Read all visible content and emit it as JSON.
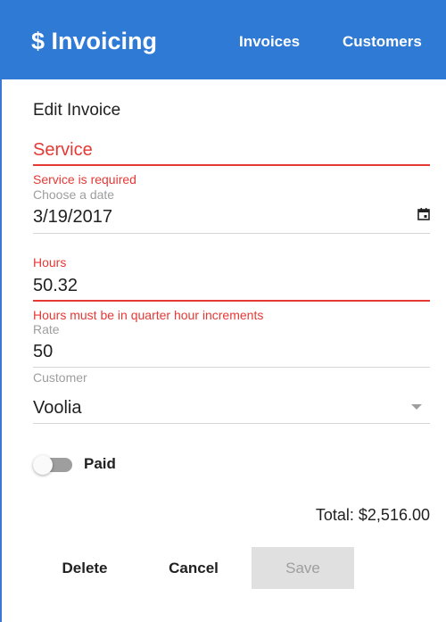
{
  "appbar": {
    "brand": "$ Invoicing",
    "nav": [
      {
        "label": "Invoices"
      },
      {
        "label": "Customers"
      }
    ]
  },
  "form": {
    "title": "Edit Invoice",
    "service": {
      "placeholder": "Service",
      "value": "",
      "error": "Service is required"
    },
    "date": {
      "label": "Choose a date",
      "value": "3/19/2017",
      "icon": "calendar-icon"
    },
    "hours": {
      "label": "Hours",
      "value": "50.32",
      "error": "Hours must be in quarter hour increments"
    },
    "rate": {
      "label": "Rate",
      "value": "50"
    },
    "customer": {
      "label": "Customer",
      "selected": "Voolia",
      "icon": "dropdown-arrow-icon"
    },
    "paid": {
      "label": "Paid",
      "checked": false
    },
    "total": "Total: $2,516.00"
  },
  "actions": {
    "delete": "Delete",
    "cancel": "Cancel",
    "save": "Save"
  },
  "colors": {
    "primary": "#2f7ad4",
    "error": "#e53935",
    "muted": "#9e9e9e",
    "disabled_bg": "#e0e0e0"
  }
}
